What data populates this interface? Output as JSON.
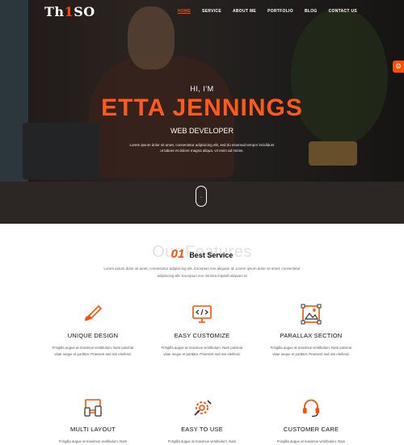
{
  "brand": {
    "logo_prefix": "Th",
    "logo_mark": "1",
    "logo_suffix": "SO"
  },
  "nav": {
    "items": [
      {
        "label": "HOME",
        "active": true
      },
      {
        "label": "SERVICE"
      },
      {
        "label": "ABOUT ME"
      },
      {
        "label": "PORTFOLIO"
      },
      {
        "label": "BLOG"
      },
      {
        "label": "CONTACT US"
      }
    ]
  },
  "side_tab": {
    "icon": "settings-gear-icon"
  },
  "hero": {
    "greeting": "HI, I'M",
    "name": "ETTA JENNINGS",
    "role": "WEB DEVELOPER",
    "description": "Lorem ipsum dolor sit amet, consectetur adipisicing elit, sed do eiusmod tempor incididunt ut labore et dolore magna aliqua. Ut enim ad minim.",
    "scroll_icon": "chevron-down-icon"
  },
  "features": {
    "number": "01",
    "label": "Best Service",
    "background_title": "Our Features",
    "description": "Lorem ipsum dolor sit amet, consectetur adipisicing elit. Excepturi eos aliquam id. Lorem ipsum dolor sit amet, consectetur adipisicing elit. Excepturi eos minima impedit aliquam id",
    "items": [
      {
        "title": "UNIQUE DESIGN",
        "icon": "paint-brush-icon",
        "text": "Fringilla augue at maximus vestibulum. Nam pulvinar vitae neque et porttitor. Praesent sed nisi eleifend."
      },
      {
        "title": "EASY CUSTOMIZE",
        "icon": "code-monitor-icon",
        "text": "Fringilla augue at maximus vestibulum. Nam pulvinar vitae neque et porttitor. Praesent sed nisi eleifend."
      },
      {
        "title": "PARALLAX SECTION",
        "icon": "image-frame-icon",
        "text": "Fringilla augue at maximus vestibulum. Nam pulvinar vitae neque et porttitor. Praesent sed nisi eleifend."
      },
      {
        "title": "MULTI LAYOUT",
        "icon": "devices-icon",
        "text": "Fringilla augue at maximus vestibulum. Nam"
      },
      {
        "title": "EASY TO USE",
        "icon": "gear-wrench-icon",
        "text": "Fringilla augue at maximus vestibulum. Nam"
      },
      {
        "title": "CUSTOMER CARE",
        "icon": "headset-icon",
        "text": "Fringilla augue at maximus vestibulum. Nam"
      }
    ]
  },
  "colors": {
    "accent": "#ff4e00",
    "text_dark": "#111111",
    "text_muted": "#666666"
  }
}
